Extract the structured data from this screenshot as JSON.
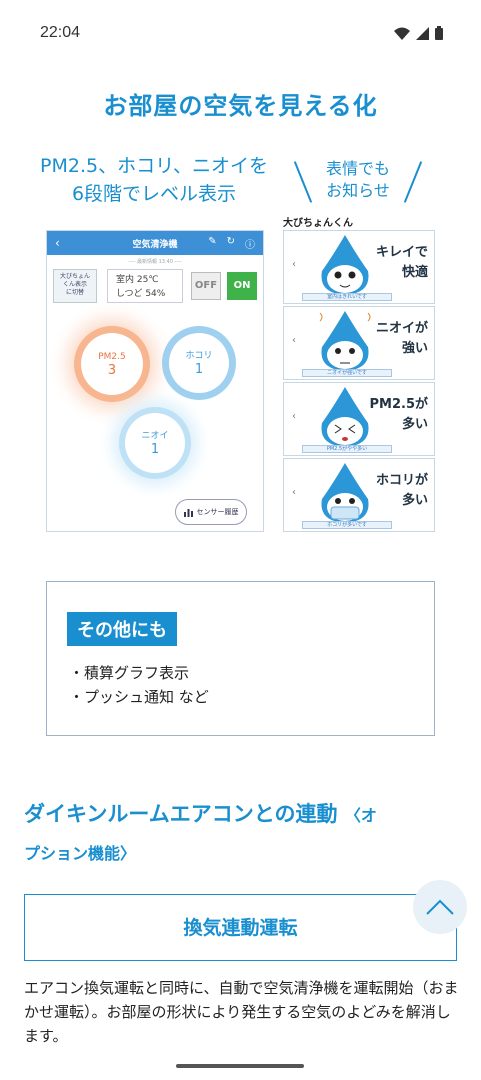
{
  "status": {
    "time": "22:04"
  },
  "page": {
    "title": "お部屋の空気を見える化"
  },
  "subhead": {
    "line1": "PM2.5、ホコリ、ニオイを",
    "line2": "6段階でレベル表示"
  },
  "bubble": {
    "line1": "表情でも",
    "line2": "お知らせ"
  },
  "app": {
    "header_title": "空気清浄機",
    "subtitle": "---- 最新情報 13:40 ----",
    "switch_label_1": "大びちょん",
    "switch_label_2": "くん表示",
    "switch_label_3": "に切替",
    "temp": "室内 25℃",
    "humidity": "しつど 54%",
    "off_label": "OFF",
    "on_label": "ON",
    "pm_label": "PM2.5",
    "pm_value": "3",
    "hokori_label": "ホコリ",
    "hokori_value": "1",
    "nioi_label": "ニオイ",
    "nioi_value": "1",
    "sensor_history": "センサー履歴"
  },
  "character": {
    "title": "大びちょんくん",
    "cards": [
      {
        "label1": "キレイで",
        "label2": "快適",
        "caption": "室内はきれいです"
      },
      {
        "label1": "ニオイが",
        "label2": "強い",
        "caption": "ニオイが強いです"
      },
      {
        "label1": "PM2.5が",
        "label2": "多い",
        "caption": "PM2.5がやや多い"
      },
      {
        "label1": "ホコリが",
        "label2": "多い",
        "caption": "ホコリが多いです"
      }
    ]
  },
  "other": {
    "tag": "その他にも",
    "items": [
      "・積算グラフ表示",
      "・プッシュ通知 など"
    ]
  },
  "section": {
    "title": "ダイキンルームエアコンとの連動",
    "option_a": "〈オ",
    "option_b": "プション機能〉"
  },
  "feature": {
    "label": "換気連動運転"
  },
  "body": {
    "text": "エアコン換気運転と同時に、自動で空気清浄機を運転開始（おまかせ運転）。お部屋の形状により発生する空気のよどみを解消します。"
  },
  "colors": {
    "accent": "#1a8fd0",
    "on_green": "#3fb24a",
    "pm_orange": "#e9753e"
  },
  "icons": [
    "wifi-icon",
    "signal-icon",
    "battery-icon",
    "back-arrow-icon",
    "edit-icon",
    "refresh-icon",
    "info-icon",
    "bar-chart-icon",
    "chevron-up-icon"
  ]
}
